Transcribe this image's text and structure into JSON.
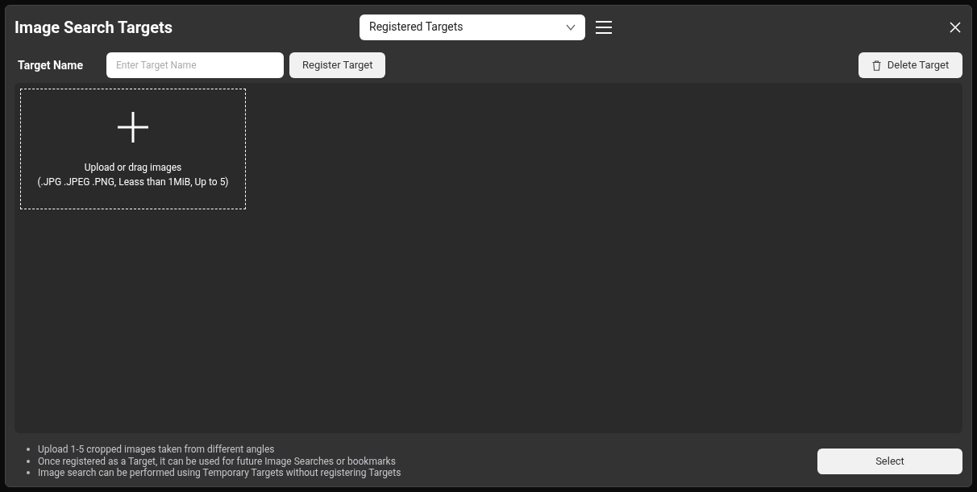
{
  "window": {
    "title": "Image Search Targets"
  },
  "view_select": {
    "value": "Registered Targets"
  },
  "target_name": {
    "label": "Target Name",
    "placeholder": "Enter Target Name"
  },
  "register_button": "Register Target",
  "delete_button": "Delete Target",
  "upload": {
    "line1": "Upload or drag images",
    "line2": "(.JPG .JPEG .PNG, Leass than 1MiB, Up to 5)"
  },
  "tips": [
    "Upload 1-5 cropped images taken from different angles",
    "Once registered as a Target, it can be used for future Image Searches or bookmarks",
    "Image search can be performed using Temporary Targets without registering Targets"
  ],
  "select_button": "Select"
}
